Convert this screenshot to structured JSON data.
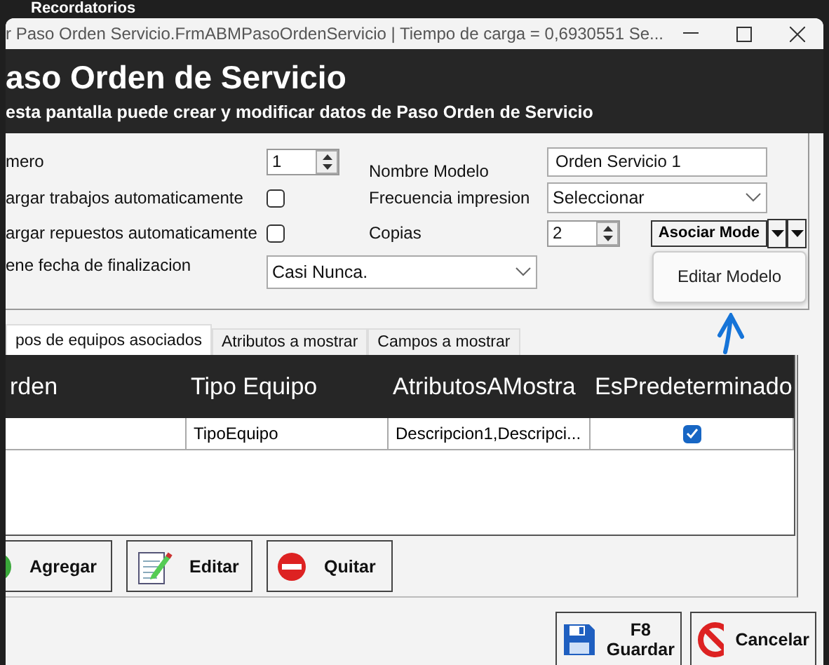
{
  "background_app": {
    "title": "Recordatorios"
  },
  "window": {
    "title": "r Paso Orden Servicio.FrmABMPasoOrdenServicio | Tiempo de carga = 0,6930551 Se..."
  },
  "header": {
    "title": "aso Orden de Servicio",
    "subtitle": "esta pantalla puede crear y modificar datos de Paso Orden de Servicio"
  },
  "form": {
    "numero": {
      "label": "mero",
      "value": "1"
    },
    "nombre_modelo": {
      "label": "Nombre Modelo",
      "value": "Orden Servicio 1"
    },
    "cargar_trabajos": {
      "label": "argar trabajos automaticamente",
      "checked": false
    },
    "frecuencia": {
      "label": "Frecuencia impresion",
      "value": "Seleccionar"
    },
    "cargar_repuestos": {
      "label": "argar repuestos automaticamente",
      "checked": false
    },
    "copias": {
      "label": "Copias",
      "value": "2"
    },
    "fecha_finalizacion": {
      "label": "ene fecha de finalizacion",
      "value": "Casi Nunca."
    },
    "asociar_button": {
      "label": "Asociar Mode"
    },
    "menu": {
      "items": [
        "Editar Modelo"
      ]
    }
  },
  "tabs": [
    {
      "label": "pos de equipos asociados",
      "selected": true
    },
    {
      "label": "Atributos a mostrar",
      "selected": false
    },
    {
      "label": "Campos a mostrar",
      "selected": false
    }
  ],
  "table": {
    "columns": [
      "rden",
      "Tipo Equipo",
      "AtributosAMostra",
      "EsPredeterminado"
    ],
    "rows": [
      {
        "cells": [
          "",
          "TipoEquipo",
          "Descripcion1,Descripci..."
        ],
        "es_predeterminado": true
      }
    ]
  },
  "actions": [
    {
      "kind": "add",
      "label": "Agregar"
    },
    {
      "kind": "edit",
      "label": "Editar"
    },
    {
      "kind": "remove",
      "label": "Quitar"
    }
  ],
  "footer": {
    "guardar": {
      "shortcut": "F8",
      "label": "Guardar"
    },
    "cancelar": {
      "label": "Cancelar"
    }
  }
}
